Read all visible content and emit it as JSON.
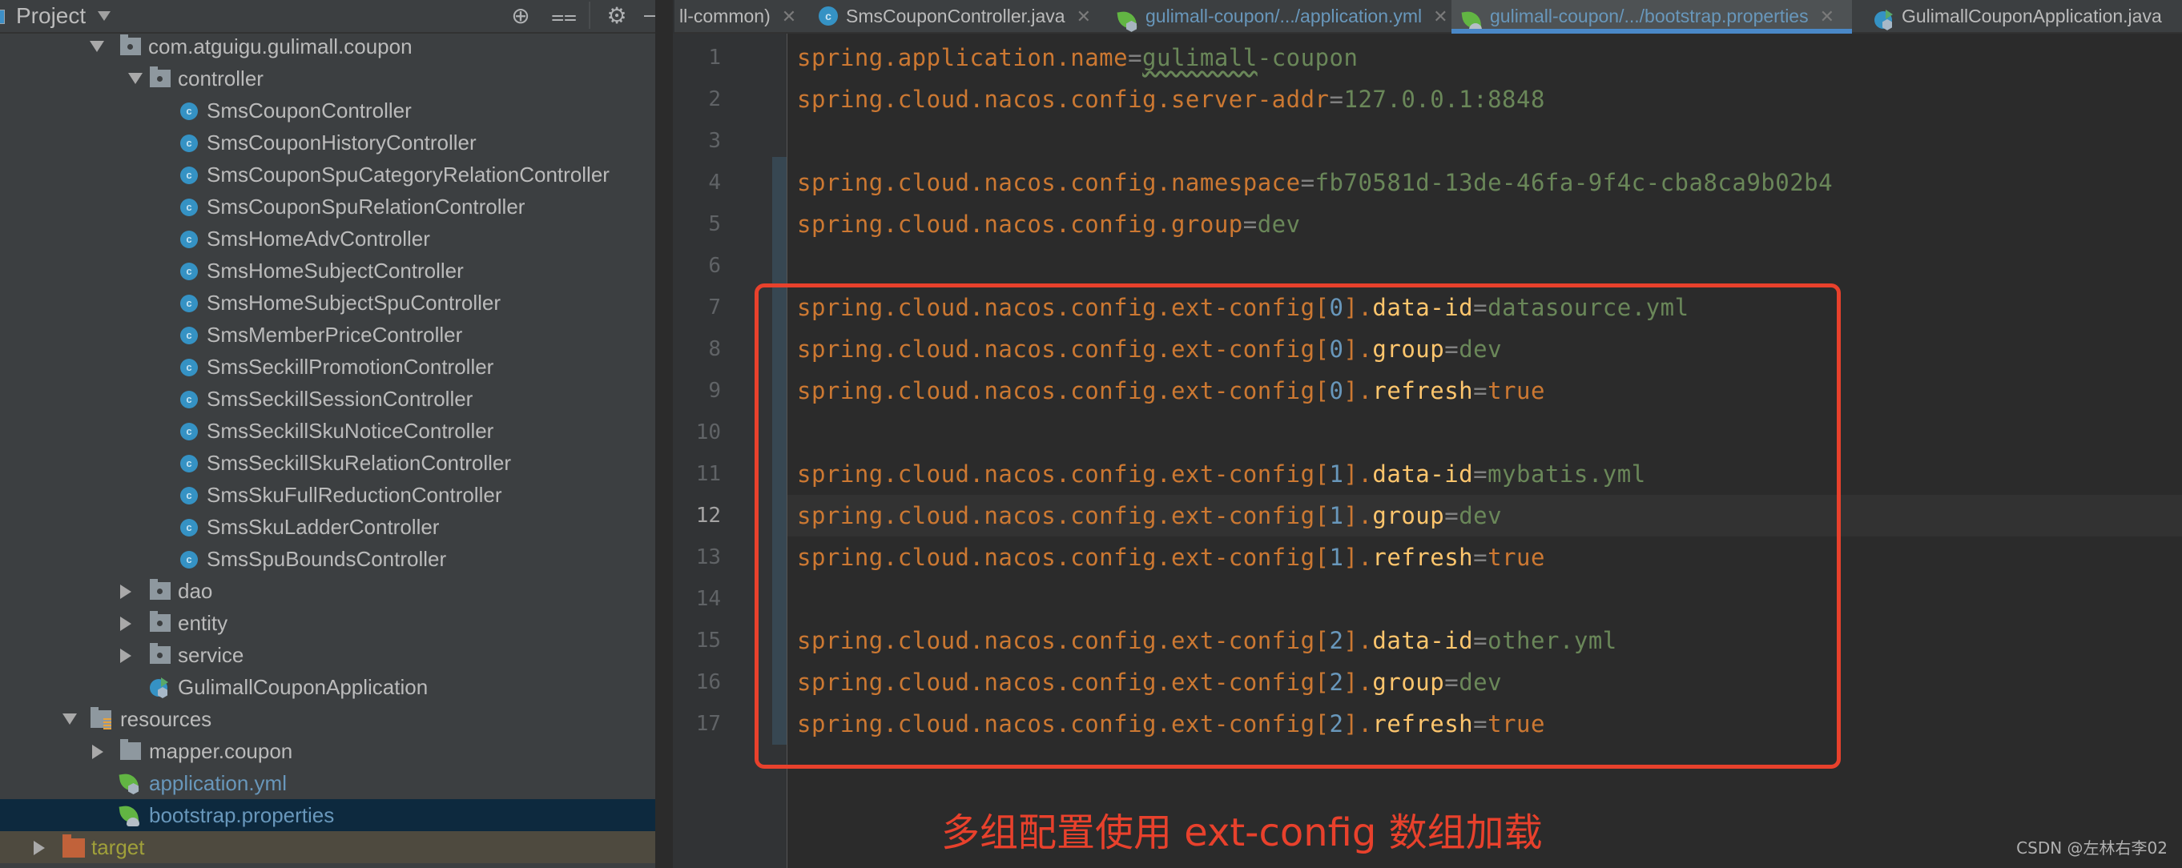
{
  "sidebar": {
    "title": "Project",
    "header_icons": [
      "locate-icon",
      "collapse-all-icon",
      "gear-icon",
      "minimize-icon"
    ],
    "tree": [
      {
        "label": "com.atguigu.gulimall.coupon",
        "kind": "package",
        "expanded": true
      },
      {
        "label": "controller",
        "kind": "package",
        "expanded": true
      },
      {
        "label": "SmsCouponController",
        "kind": "class"
      },
      {
        "label": "SmsCouponHistoryController",
        "kind": "class"
      },
      {
        "label": "SmsCouponSpuCategoryRelationController",
        "kind": "class"
      },
      {
        "label": "SmsCouponSpuRelationController",
        "kind": "class"
      },
      {
        "label": "SmsHomeAdvController",
        "kind": "class"
      },
      {
        "label": "SmsHomeSubjectController",
        "kind": "class"
      },
      {
        "label": "SmsHomeSubjectSpuController",
        "kind": "class"
      },
      {
        "label": "SmsMemberPriceController",
        "kind": "class"
      },
      {
        "label": "SmsSeckillPromotionController",
        "kind": "class"
      },
      {
        "label": "SmsSeckillSessionController",
        "kind": "class"
      },
      {
        "label": "SmsSeckillSkuNoticeController",
        "kind": "class"
      },
      {
        "label": "SmsSeckillSkuRelationController",
        "kind": "class"
      },
      {
        "label": "SmsSkuFullReductionController",
        "kind": "class"
      },
      {
        "label": "SmsSkuLadderController",
        "kind": "class"
      },
      {
        "label": "SmsSpuBoundsController",
        "kind": "class"
      },
      {
        "label": "dao",
        "kind": "package",
        "expanded": false
      },
      {
        "label": "entity",
        "kind": "package",
        "expanded": false
      },
      {
        "label": "service",
        "kind": "package",
        "expanded": false
      },
      {
        "label": "GulimallCouponApplication",
        "kind": "app-class"
      },
      {
        "label": "resources",
        "kind": "resources-folder",
        "expanded": true
      },
      {
        "label": "mapper.coupon",
        "kind": "folder",
        "expanded": false
      },
      {
        "label": "application.yml",
        "kind": "spring-yml"
      },
      {
        "label": "bootstrap.properties",
        "kind": "spring-properties",
        "selected": true
      },
      {
        "label": "target",
        "kind": "excluded-folder",
        "expanded": false
      }
    ]
  },
  "tabs": [
    {
      "label": "ll-common)",
      "icon": "none",
      "active": false
    },
    {
      "label": "SmsCouponController.java",
      "icon": "class-icon",
      "active": false
    },
    {
      "label": "gulimall-coupon/.../application.yml",
      "icon": "spring-yml-icon",
      "active": false
    },
    {
      "label": "gulimall-coupon/.../bootstrap.properties",
      "icon": "spring-properties-icon",
      "active": true
    },
    {
      "label": "GulimallCouponApplication.java",
      "icon": "app-class-icon",
      "active": false
    }
  ],
  "editor": {
    "current_line": 12,
    "lines": [
      {
        "n": "1",
        "key": "spring.application.name",
        "value": "gulimall-coupon"
      },
      {
        "n": "2",
        "key": "spring.cloud.nacos.config.server-addr",
        "value": "127.0.0.1:8848"
      },
      {
        "n": "3"
      },
      {
        "n": "4",
        "key": "spring.cloud.nacos.config.namespace",
        "value": "fb70581d-13de-46fa-9f4c-cba8ca9b02b4"
      },
      {
        "n": "5",
        "key": "spring.cloud.nacos.config.group",
        "value": "dev"
      },
      {
        "n": "6"
      },
      {
        "n": "7",
        "prefix": "spring.cloud.nacos.config.ext-config",
        "index": "0",
        "prop": "data-id",
        "value": "datasource.yml"
      },
      {
        "n": "8",
        "prefix": "spring.cloud.nacos.config.ext-config",
        "index": "0",
        "prop": "group",
        "value": "dev"
      },
      {
        "n": "9",
        "prefix": "spring.cloud.nacos.config.ext-config",
        "index": "0",
        "prop": "refresh",
        "value": "true",
        "keyword": true
      },
      {
        "n": "10"
      },
      {
        "n": "11",
        "prefix": "spring.cloud.nacos.config.ext-config",
        "index": "1",
        "prop": "data-id",
        "value": "mybatis.yml"
      },
      {
        "n": "12",
        "prefix": "spring.cloud.nacos.config.ext-config",
        "index": "1",
        "prop": "group",
        "value": "dev"
      },
      {
        "n": "13",
        "prefix": "spring.cloud.nacos.config.ext-config",
        "index": "1",
        "prop": "refresh",
        "value": "true",
        "keyword": true
      },
      {
        "n": "14"
      },
      {
        "n": "15",
        "prefix": "spring.cloud.nacos.config.ext-config",
        "index": "2",
        "prop": "data-id",
        "value": "other.yml"
      },
      {
        "n": "16",
        "prefix": "spring.cloud.nacos.config.ext-config",
        "index": "2",
        "prop": "group",
        "value": "dev"
      },
      {
        "n": "17",
        "prefix": "spring.cloud.nacos.config.ext-config",
        "index": "2",
        "prop": "refresh",
        "value": "true",
        "keyword": true
      }
    ]
  },
  "annotation": {
    "text": "多组配置使用 ext-config 数组加载",
    "color": "#e8412c"
  },
  "watermark": "CSDN @左林右李02",
  "colors": {
    "key": "#cc7832",
    "value": "#6a8759",
    "index": "#6897bb",
    "property": "#ffc66d",
    "active_tab_underline": "#4a88c7",
    "selection": "#0d293e"
  }
}
